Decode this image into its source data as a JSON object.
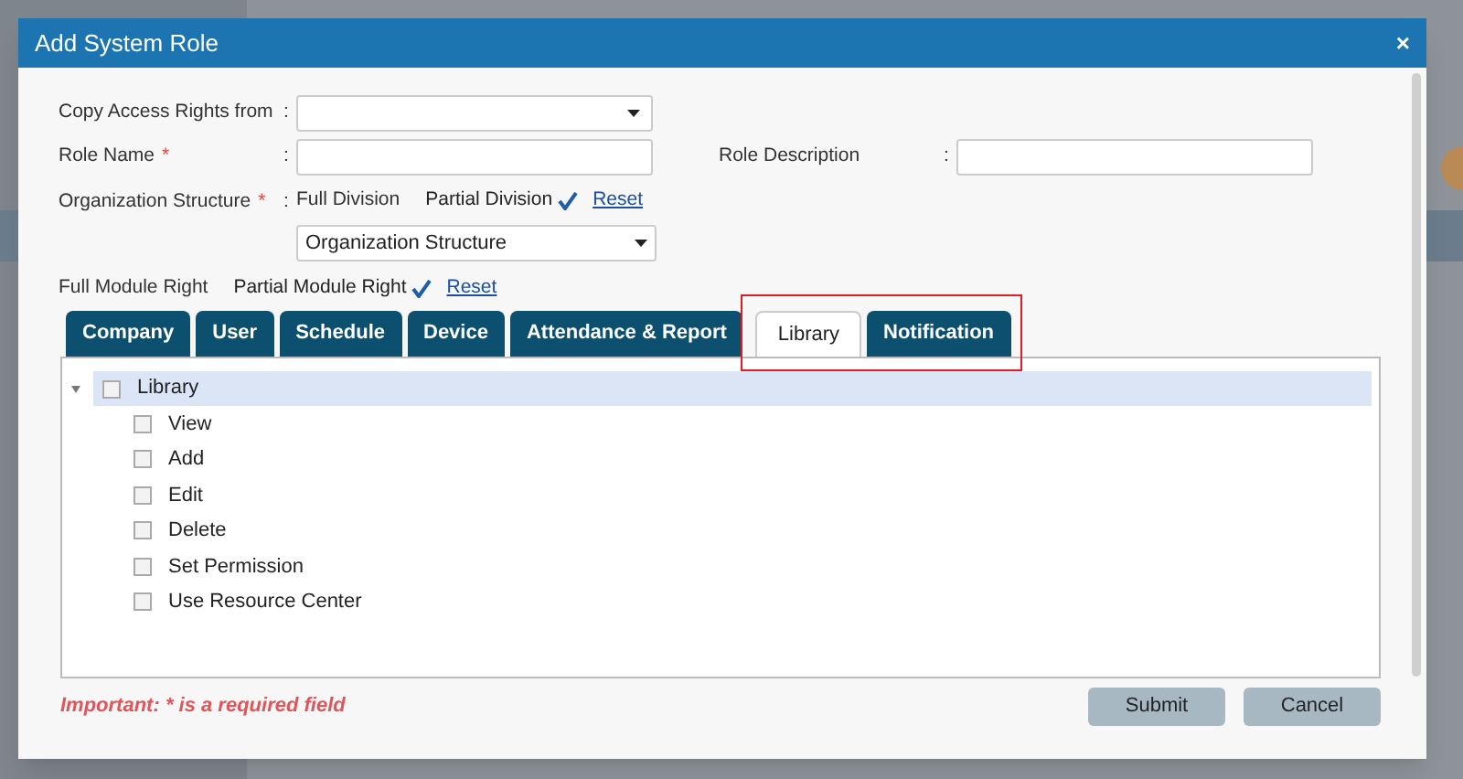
{
  "dialog": {
    "title": "Add System Role",
    "close": "×"
  },
  "form": {
    "copy_access": {
      "label": "Copy Access Rights from",
      "colon": ":"
    },
    "role_name": {
      "label": "Role Name",
      "required_mark": "*",
      "colon": ":"
    },
    "role_description": {
      "label": "Role Description",
      "colon": ":"
    },
    "organization_structure": {
      "label": "Organization Structure",
      "required_mark": "*",
      "colon": ":",
      "options": [
        {
          "label": "Full Division",
          "selected": false
        },
        {
          "label": "Partial Division",
          "selected": true
        }
      ],
      "reset": "Reset",
      "dropdown": "Organization Structure"
    }
  },
  "module_right": {
    "options": [
      {
        "label": "Full Module Right",
        "selected": false
      },
      {
        "label": "Partial Module Right",
        "selected": true
      }
    ],
    "reset": "Reset"
  },
  "tabs": [
    {
      "label": "Company",
      "selected": false
    },
    {
      "label": "User",
      "selected": false
    },
    {
      "label": "Schedule",
      "selected": false
    },
    {
      "label": "Device",
      "selected": false
    },
    {
      "label": "Attendance & Report",
      "selected": false
    },
    {
      "label": "Library",
      "selected": true
    },
    {
      "label": "Notification",
      "selected": false
    }
  ],
  "tree": [
    {
      "label": "Library",
      "checked": false,
      "expanded": true,
      "children": [
        {
          "label": "View",
          "checked": false
        },
        {
          "label": "Add",
          "checked": false
        },
        {
          "label": "Edit",
          "checked": false
        },
        {
          "label": "Delete",
          "checked": false
        },
        {
          "label": "Set Permission",
          "checked": false
        },
        {
          "label": "Use Resource Center",
          "checked": false
        }
      ]
    }
  ],
  "note": "Important: * is a required field",
  "buttons": [
    "Submit",
    "Cancel"
  ]
}
